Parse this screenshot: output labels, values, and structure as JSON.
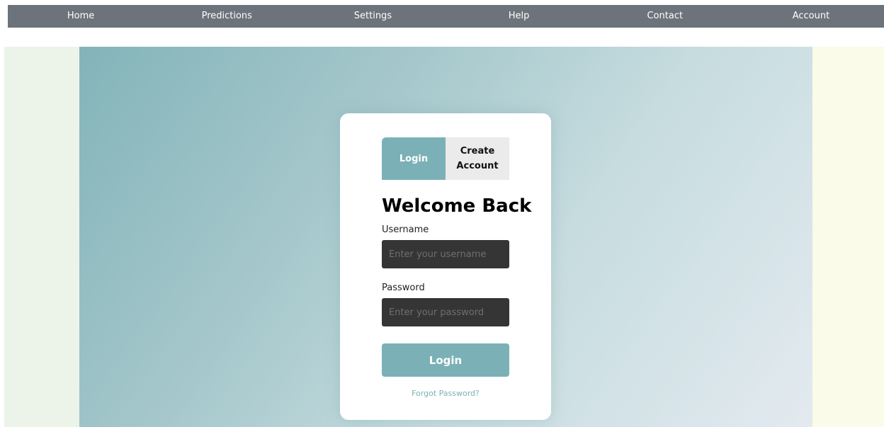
{
  "nav": {
    "items": [
      {
        "label": "Home"
      },
      {
        "label": "Predictions"
      },
      {
        "label": "Settings"
      },
      {
        "label": "Help"
      },
      {
        "label": "Contact"
      },
      {
        "label": "Account"
      }
    ]
  },
  "auth": {
    "tabs": {
      "login": "Login",
      "create_line1": "Create",
      "create_line2": "Account"
    },
    "title": "Welcome Back",
    "username": {
      "label": "Username",
      "placeholder": "Enter your username",
      "value": ""
    },
    "password": {
      "label": "Password",
      "placeholder": "Enter your password",
      "value": ""
    },
    "submit_label": "Login",
    "forgot_label": "Forgot Password?"
  },
  "colors": {
    "nav_bg": "#6c737b",
    "accent": "#7bb1b6",
    "input_bg": "#353535"
  }
}
